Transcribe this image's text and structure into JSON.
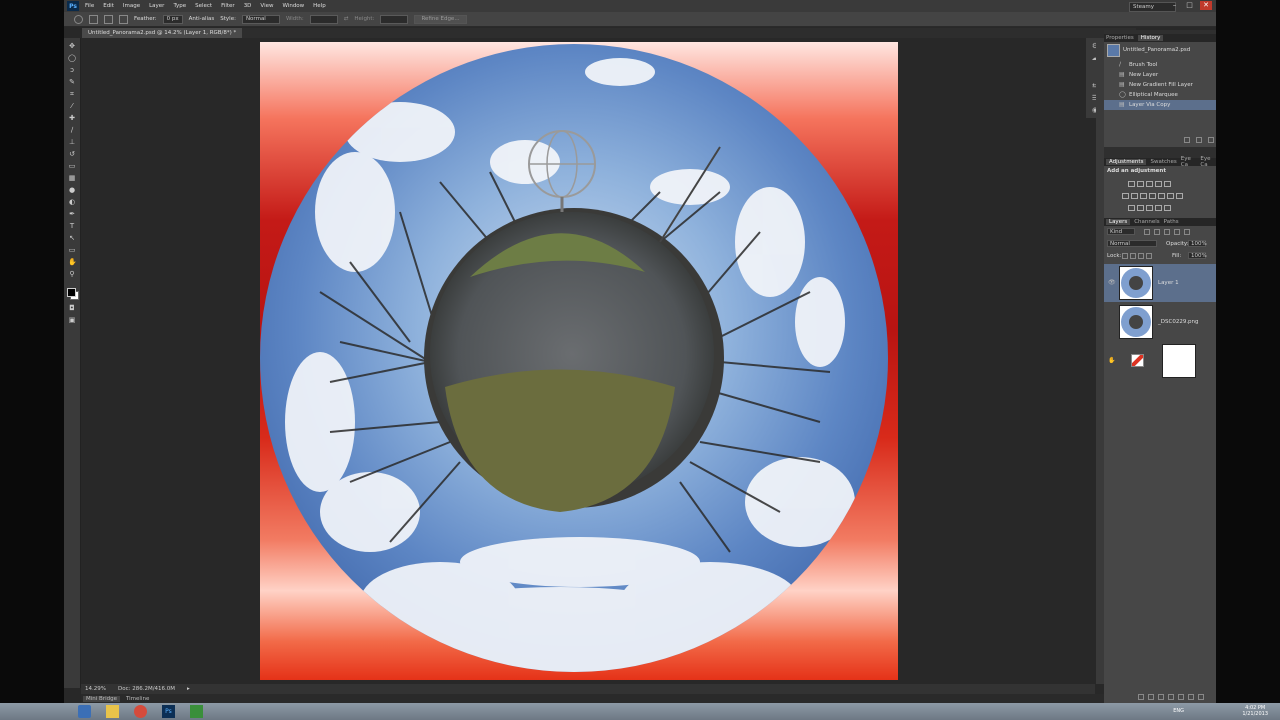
{
  "app": {
    "logo": "Ps",
    "menu": [
      "File",
      "Edit",
      "Image",
      "Layer",
      "Type",
      "Select",
      "Filter",
      "3D",
      "View",
      "Window",
      "Help"
    ],
    "workspace": "Steamy"
  },
  "options": {
    "feather_label": "Feather:",
    "feather_value": "0 px",
    "antialias": "Anti-alias",
    "style_label": "Style:",
    "style_value": "Normal",
    "width_label": "Width:",
    "height_label": "Height:",
    "refine_label": "Refine Edge..."
  },
  "document": {
    "tab": "Untitled_Panorama2.psd @ 14.2% (Layer 1, RGB/8*) *",
    "zoom": "14.29%",
    "doc_size": "Doc: 286.2M/416.0M"
  },
  "bottom_tabs": [
    "Mini Bridge",
    "Timeline"
  ],
  "history": {
    "tabs": [
      "Properties",
      "History"
    ],
    "snapshot": "Untitled_Panorama2.psd",
    "items": [
      "Brush Tool",
      "New Layer",
      "New Gradient Fill Layer",
      "Elliptical Marquee",
      "Layer Via Copy"
    ]
  },
  "adjustments": {
    "tabs": [
      "Adjustments",
      "Swatches",
      "Eye Ca",
      "Eye Ca"
    ],
    "title": "Add an adjustment"
  },
  "layers": {
    "tabs": [
      "Layers",
      "Channels",
      "Paths"
    ],
    "kind": "Kind",
    "blend": "Normal",
    "opacity_label": "Opacity:",
    "opacity": "100%",
    "lock_label": "Lock:",
    "fill_label": "Fill:",
    "fill": "100%",
    "items": [
      {
        "name": "Layer 1"
      },
      {
        "name": "_DSC0229.png"
      },
      {
        "name": ""
      }
    ]
  },
  "taskbar": {
    "lang": "ENG",
    "time": "4:02 PM",
    "date": "1/21/2013"
  },
  "colors": {
    "accent": "#5c6f8c",
    "gradient_red": "#c41a17"
  }
}
